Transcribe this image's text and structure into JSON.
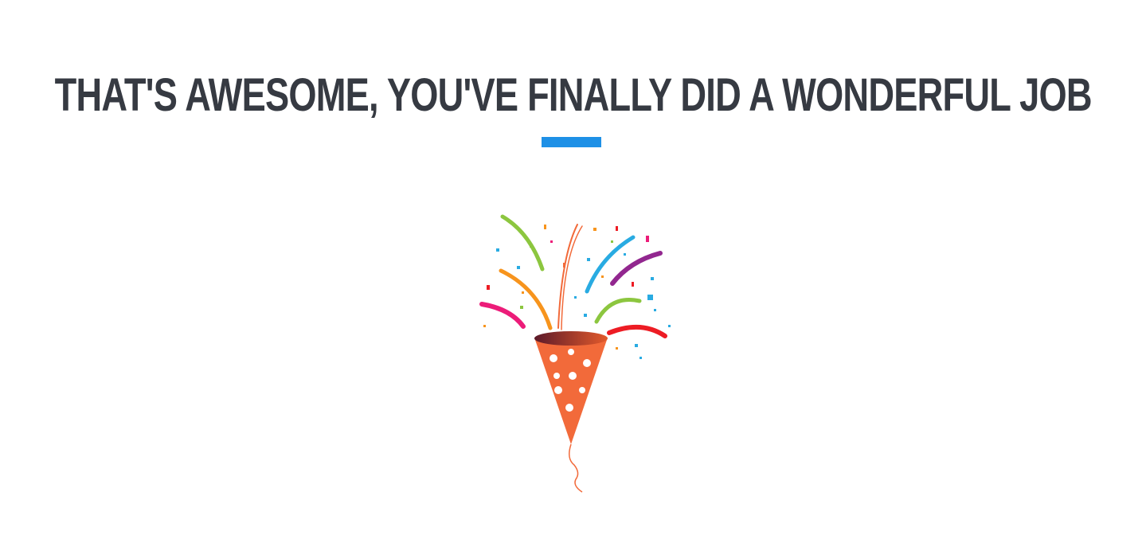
{
  "heading": {
    "text": "THAT'S AWESOME, YOU'VE FINALLY DID A WONDERFUL JOB",
    "leading_icon": "cubes-icon",
    "trailing_icon": "heart-icon",
    "text_color": "#363a42"
  },
  "accent": {
    "underline_color": "#1e90e6"
  },
  "illustration": {
    "subject": "party-popper-icon"
  }
}
